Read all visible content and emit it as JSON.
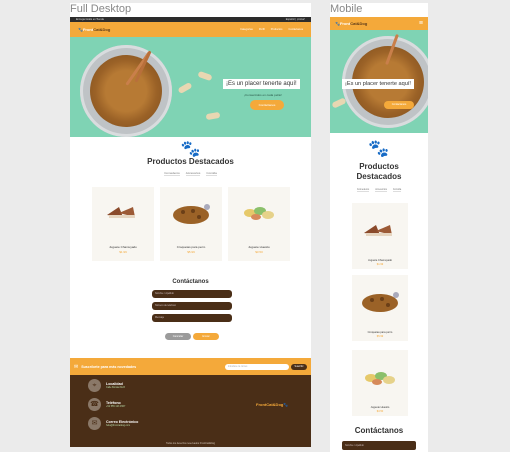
{
  "frames": {
    "desktop_title": "Full Desktop",
    "mobile_title": "Mobile"
  },
  "brand": {
    "logo_main": "Front",
    "logo_accent": "Cat&Dog"
  },
  "topbar": {
    "left": "Entrega Gratis en Tienda",
    "right": "Español  |  ¡Iniciar!"
  },
  "nav": {
    "links": [
      "Categorías",
      "Perfil",
      "Productos",
      "Contáctanos"
    ]
  },
  "hero": {
    "headline": "¡Es un placer tenerte aquí!",
    "subtitle": "¡Consentidos en cada pelito!",
    "cta": "Contáctanos"
  },
  "products": {
    "title": "Productos Destacados",
    "mobile_title_line1": "Productos",
    "mobile_title_line2": "Destacados",
    "tabs": [
      "Comederos",
      "Accesorios",
      "Comida"
    ],
    "items": [
      {
        "name": "Juguete Chamuyado",
        "price": "$1.99"
      },
      {
        "name": "Croquetas para perro",
        "price": "$5.99"
      },
      {
        "name": "Juguete Huesito",
        "price": "$3.50"
      }
    ]
  },
  "contact": {
    "title": "Contáctanos",
    "fields": [
      "Nombre / Apellido",
      "Número de teléfono",
      "Mensaje"
    ],
    "cancel": "Cancelar",
    "send": "Enviar"
  },
  "subscribe": {
    "text": "Suscríbete para más novedades",
    "placeholder": "Introduce tu correo",
    "button": "Suscribir"
  },
  "footer": {
    "items": [
      {
        "title": "Localidad",
        "sub": "Calle Bonita #123"
      },
      {
        "title": "Teléfono",
        "sub": "+52 555 123 4567"
      },
      {
        "title": "Correo Electrónico",
        "sub": "hola@frontcatdog.com"
      }
    ],
    "copyright": "Todos los derechos reservados FrontCat&Dog"
  },
  "colors": {
    "accent": "#f4a93a",
    "dark": "#4a2e17",
    "mint": "#7fd3b4"
  }
}
